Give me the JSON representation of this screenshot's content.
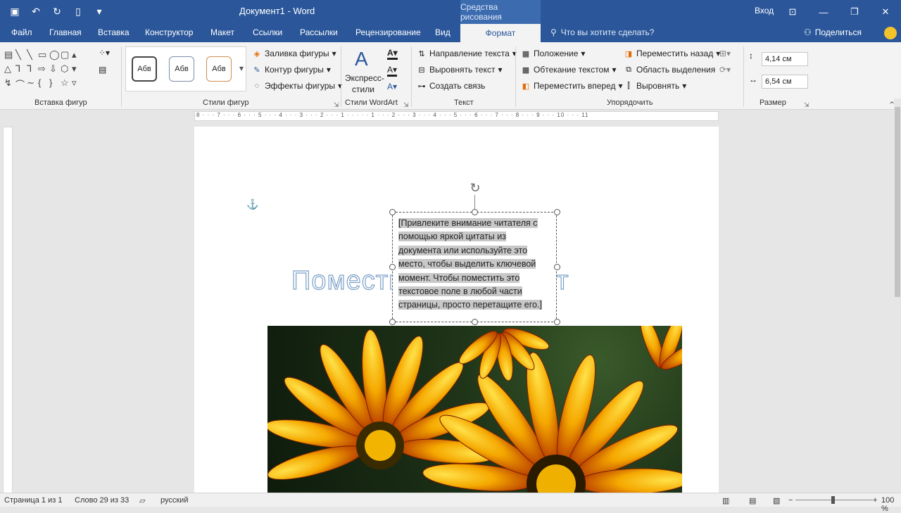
{
  "titlebar": {
    "doc_title": "Документ1  -  Word",
    "context_title": "Средства рисования",
    "signin": "Вход",
    "icons": [
      "save-icon",
      "undo-icon",
      "redo-icon",
      "new-doc-icon",
      "customize-qat-icon"
    ]
  },
  "tabs": {
    "file": "Файл",
    "home": "Главная",
    "insert": "Вставка",
    "design": "Конструктор",
    "layout": "Макет",
    "references": "Ссылки",
    "mailings": "Рассылки",
    "review": "Рецензирование",
    "view": "Вид",
    "format": "Формат",
    "tell_me": "Что вы хотите сделать?",
    "share": "Поделиться"
  },
  "ribbon": {
    "insert_shapes_label": "Вставка фигур",
    "shape_styles_label": "Стили фигур",
    "style_preview": "Абв",
    "fill": "Заливка фигуры",
    "outline": "Контур фигуры",
    "effects": "Эффекты фигуры",
    "wordart_label": "Стили WordArt",
    "quick_styles_line1": "Экспресс-",
    "quick_styles_line2": "стили",
    "text_direction": "Направление текста",
    "align_text": "Выровнять текст",
    "create_link": "Создать связь",
    "text_label": "Текст",
    "position": "Положение",
    "wrap_text": "Обтекание текстом",
    "bring_forward": "Переместить вперед",
    "send_backward": "Переместить назад",
    "selection_pane": "Область выделения",
    "align": "Выровнять",
    "arrange_label": "Упорядочить",
    "height": "4,14 см",
    "width": "6,54 см",
    "size_label": "Размер"
  },
  "ruler": {
    "marks": "8 · · · 7 · · · 6 · · · 5 · · · 4 · · · 3 · · · 2 · · · 1 · · · · · 1 · · · 2 · · · 3 · · · 4 · · · 5 · · · 6 · · · 7 · · · 8 · · · 9 · · · 10 · · · 11"
  },
  "document": {
    "heading": "Поместите ваш текст",
    "textbox": "[Привлеките внимание читателя с помощью яркой цитаты из документа или используйте это место, чтобы выделить ключевой момент. Чтобы поместить это текстовое поле в любой части страницы, просто перетащите его.]"
  },
  "status": {
    "page": "Страница 1 из 1",
    "words": "Слово 29 из 33",
    "language": "русский",
    "zoom": "100 %"
  }
}
